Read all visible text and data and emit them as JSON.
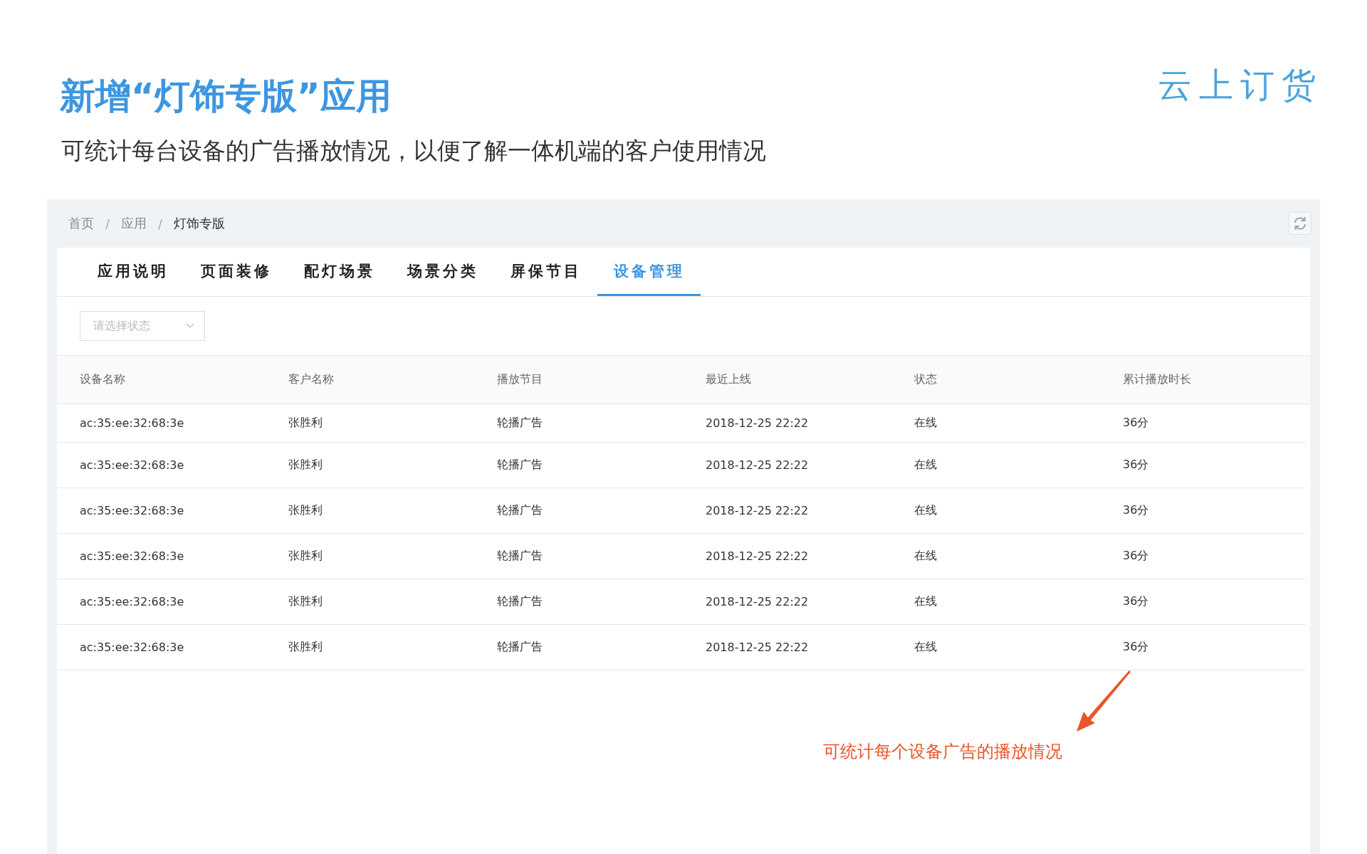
{
  "slide": {
    "title": "新增“灯饰专版”应用",
    "subtitle": "可统计每台设备的广告播放情况，以便了解一体机端的客户使用情况",
    "logo": "云上订货"
  },
  "breadcrumb": [
    "首页",
    "应用",
    "灯饰专版"
  ],
  "breadcrumb_separator": "/",
  "tabs": [
    {
      "label": "应用说明",
      "selected": false
    },
    {
      "label": "页面装修",
      "selected": false
    },
    {
      "label": "配灯场景",
      "selected": false
    },
    {
      "label": "场景分类",
      "selected": false
    },
    {
      "label": "屏保节目",
      "selected": false
    },
    {
      "label": "设备管理",
      "selected": true
    }
  ],
  "filter": {
    "placeholder": "请选择状态"
  },
  "table": {
    "columns": [
      "设备名称",
      "客户名称",
      "播放节目",
      "最近上线",
      "状态",
      "累计播放时长"
    ],
    "rows": [
      [
        "ac:35:ee:32:68:3e",
        "张胜利",
        "轮播广告",
        "2018-12-25 22:22",
        "在线",
        "36分"
      ],
      [
        "ac:35:ee:32:68:3e",
        "张胜利",
        "轮播广告",
        "2018-12-25 22:22",
        "在线",
        "36分"
      ],
      [
        "ac:35:ee:32:68:3e",
        "张胜利",
        "轮播广告",
        "2018-12-25 22:22",
        "在线",
        "36分"
      ],
      [
        "ac:35:ee:32:68:3e",
        "张胜利",
        "轮播广告",
        "2018-12-25 22:22",
        "在线",
        "36分"
      ],
      [
        "ac:35:ee:32:68:3e",
        "张胜利",
        "轮播广告",
        "2018-12-25 22:22",
        "在线",
        "36分"
      ],
      [
        "ac:35:ee:32:68:3e",
        "张胜利",
        "轮播广告",
        "2018-12-25 22:22",
        "在线",
        "36分"
      ]
    ]
  },
  "annotation": "可统计每个设备广告的播放情况"
}
